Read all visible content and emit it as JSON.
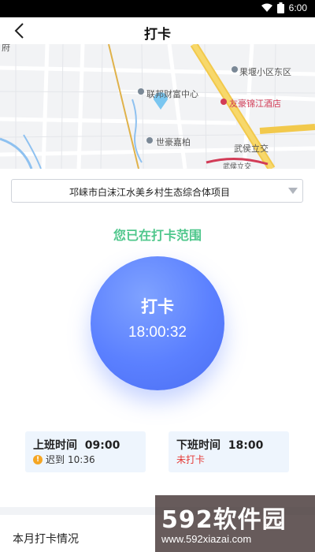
{
  "status_bar": {
    "time": "6:00"
  },
  "header": {
    "title": "打卡"
  },
  "map": {
    "labels": {
      "fenghuang": "联邦财富中心",
      "guoyan": "果堰小区东区",
      "hotel": "友豪锦江酒店",
      "shihao": "世豪嘉柏",
      "wuhou": "武侯立交",
      "wuhou2": "武侯立交",
      "edge": "府"
    }
  },
  "project_selector": {
    "value": "邛崃市白沫江水美乡村生态综合体项目"
  },
  "range_status": "您已在打卡范围",
  "punch_button": {
    "label": "打卡",
    "time": "18:00:32"
  },
  "check_in": {
    "title": "上班时间",
    "time": "09:00",
    "status": "迟到",
    "status_time": "10:36"
  },
  "check_out": {
    "title": "下班时间",
    "time": "18:00",
    "status": "未打卡"
  },
  "monthly": {
    "title": "本月打卡情况"
  },
  "watermark": {
    "brand": "592软件园",
    "url": "www.592xiazai.com"
  },
  "colors": {
    "accent": "#5b80ff",
    "success": "#4fc78c",
    "danger": "#e53935",
    "warning": "#f5a623"
  }
}
